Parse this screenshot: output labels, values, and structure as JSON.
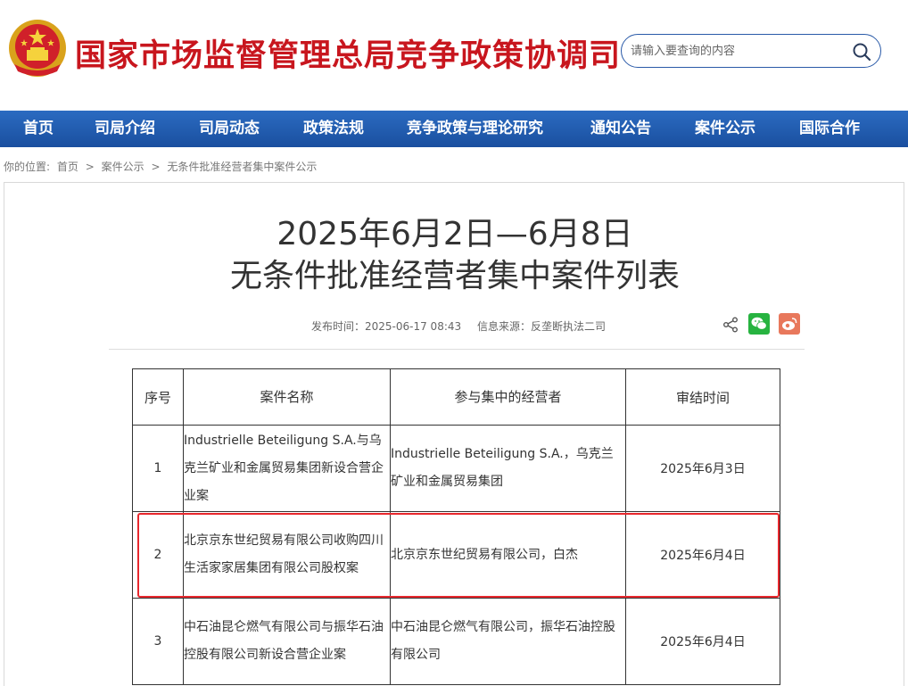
{
  "header": {
    "site_title": "国家市场监督管理总局竞争政策协调司",
    "search_placeholder": "请输入要查询的内容"
  },
  "nav": {
    "items": [
      "首页",
      "司局介绍",
      "司局动态",
      "政策法规",
      "竞争政策与理论研究",
      "通知公告",
      "案件公示",
      "国际合作"
    ]
  },
  "breadcrumb": {
    "prefix": "你的位置:",
    "items": [
      "首页",
      "案件公示",
      "无条件批准经营者集中案件公示"
    ],
    "separator": ">"
  },
  "article": {
    "title_line1": "2025年6月2日—6月8日",
    "title_line2": "无条件批准经营者集中案件列表",
    "publish_time": "发布时间：2025-06-17 08:43",
    "source": "信息来源：反垄断执法二司"
  },
  "table": {
    "headers": [
      "序号",
      "案件名称",
      "参与集中的经营者",
      "审结时间"
    ],
    "rows": [
      {
        "no": "1",
        "name": "Industrielle Beteiligung S.A.与乌克兰矿业和金属贸易集团新设合营企业案",
        "parties": "Industrielle Beteiligung S.A.，乌克兰矿业和金属贸易集团",
        "date": "2025年6月3日"
      },
      {
        "no": "2",
        "name": "北京京东世纪贸易有限公司收购四川生活家家居集团有限公司股权案",
        "parties": "北京京东世纪贸易有限公司，白杰",
        "date": "2025年6月4日"
      },
      {
        "no": "3",
        "name": "中石油昆仑燃气有限公司与振华石油控股有限公司新设合营企业案",
        "parties": "中石油昆仑燃气有限公司，振华石油控股有限公司",
        "date": "2025年6月4日"
      }
    ]
  },
  "colors": {
    "title_red": "#c8161e",
    "nav_blue": "#1a4f9f",
    "highlight_red": "#e8282d",
    "wechat_green": "#27b340",
    "weibo_orange": "#e8785c"
  },
  "icons": {
    "emblem": "national-emblem",
    "search": "search-icon",
    "share": "share-icon",
    "wechat": "wechat-icon",
    "weibo": "weibo-icon"
  }
}
